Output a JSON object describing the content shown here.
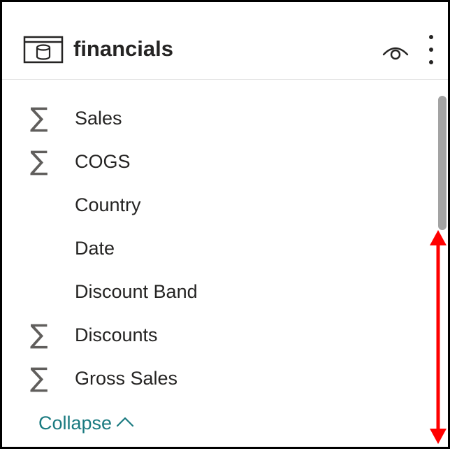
{
  "table": {
    "title": "financials",
    "icon": "table-icon"
  },
  "header_actions": {
    "visibility_icon": "eye-icon",
    "more_icon": "more-options-icon"
  },
  "fields": [
    {
      "label": "Sales",
      "aggregate": true
    },
    {
      "label": "COGS",
      "aggregate": true
    },
    {
      "label": "Country",
      "aggregate": false
    },
    {
      "label": "Date",
      "aggregate": false
    },
    {
      "label": "Discount Band",
      "aggregate": false
    },
    {
      "label": "Discounts",
      "aggregate": true
    },
    {
      "label": "Gross Sales",
      "aggregate": true
    }
  ],
  "aggregate_symbol": "∑",
  "collapse_label": "Collapse",
  "colors": {
    "link": "#1a7a80",
    "text": "#252423",
    "icon": "#605e5c",
    "annotation": "#ff0000"
  }
}
